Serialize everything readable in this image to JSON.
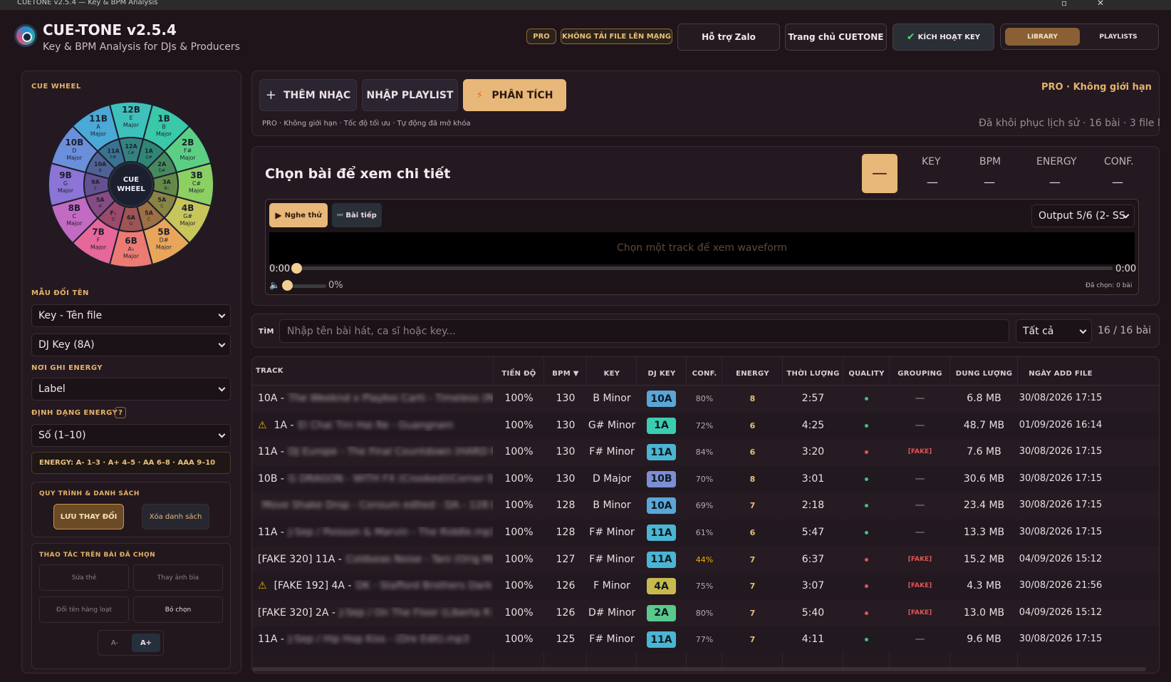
{
  "window": {
    "title": "CUETONE v2.5.4 — Key & BPM Analysis",
    "controls": [
      "▫",
      "✕"
    ]
  },
  "header": {
    "app_name": "CUE-TONE v2.5.4",
    "subtitle": "Key & BPM Analysis for DJs & Producers",
    "pro_badge": "PRO",
    "no_upload_badge": "KHÔNG TẢI FILE LÊN MẠNG",
    "zalo_button": "Hỗ trợ Zalo",
    "home_button": "Trang chủ CUETONE",
    "activate_button": "KÍCH HOẠT KEY",
    "check_icon": "✔",
    "library_tab": "LIBRARY",
    "playlists_tab": "PLAYLISTS"
  },
  "sidebar": {
    "wheel_label": "CUE WHEEL",
    "wheel_center": [
      "CUE",
      "WHEEL"
    ],
    "wheel_outer": [
      {
        "code": "12B",
        "note": "E",
        "mode": "Major",
        "color": "#3fc1bb"
      },
      {
        "code": "1B",
        "note": "B",
        "mode": "Major",
        "color": "#39c9a8"
      },
      {
        "code": "2B",
        "note": "F#",
        "mode": "Major",
        "color": "#5ccf84"
      },
      {
        "code": "3B",
        "note": "C#",
        "mode": "Major",
        "color": "#8ccf62"
      },
      {
        "code": "4B",
        "note": "G#",
        "mode": "Major",
        "color": "#c8c55a"
      },
      {
        "code": "5B",
        "note": "D#",
        "mode": "Major",
        "color": "#e9a55a"
      },
      {
        "code": "6B",
        "note": "A♭",
        "mode": "Major",
        "color": "#ec7b73"
      },
      {
        "code": "7B",
        "note": "F",
        "mode": "Major",
        "color": "#e7679b"
      },
      {
        "code": "8B",
        "note": "C",
        "mode": "Major",
        "color": "#c36ac2"
      },
      {
        "code": "9B",
        "note": "G",
        "mode": "Major",
        "color": "#8c75d6"
      },
      {
        "code": "10B",
        "note": "D",
        "mode": "Major",
        "color": "#6c8fdc"
      },
      {
        "code": "11B",
        "note": "A",
        "mode": "Major",
        "color": "#4aa9d6"
      }
    ],
    "wheel_inner": [
      {
        "code": "12A",
        "note": "C#"
      },
      {
        "code": "1A",
        "note": "G#"
      },
      {
        "code": "2A",
        "note": "D#"
      },
      {
        "code": "3A",
        "note": "B♭"
      },
      {
        "code": "5A",
        "note": "C"
      },
      {
        "code": "5A",
        "note": "C"
      },
      {
        "code": "6A",
        "note": "G"
      },
      {
        "code": "F♭",
        "note": "D"
      },
      {
        "code": "5A",
        "note": "A"
      },
      {
        "code": "9A",
        "note": "E"
      },
      {
        "code": "10A",
        "note": "B"
      },
      {
        "code": "11A",
        "note": "F#"
      }
    ],
    "rename_label": "MẪU ĐỔI TÊN",
    "rename_pattern": "Key - Tên file",
    "key_format": "DJ Key (8A)",
    "energy_target_label": "NƠI GHI ENERGY",
    "energy_target": "Label",
    "energy_format_label": "ĐỊNH DẠNG ENERGY",
    "help_icon": "?",
    "energy_format": "Số (1–10)",
    "energy_legend": "ENERGY: A- 1–3 · A+ 4–5 · AA 6–8 · AAA 9–10",
    "workflow_label": "QUY TRÌNH & DANH SÁCH",
    "save_button": "LƯU THAY ĐỔI",
    "clear_list_button": "Xóa danh sách",
    "selected_actions_label": "THAO TÁC TRÊN BÀI ĐÃ CHỌN",
    "edit_tag_button": "Sửa thẻ",
    "change_cover_button": "Thay ảnh bìa",
    "batch_rename_button": "Đổi tên hàng loạt",
    "deselect_button": "Bỏ chọn",
    "font_minus": "A-",
    "font_plus": "A+"
  },
  "toolbar": {
    "add_music": "THÊM NHẠC",
    "plus_icon": "+",
    "import_playlist": "NHẬP PLAYLIST",
    "analyze": "PHÂN TÍCH",
    "bolt_icon": "⚡",
    "pro_status": "PRO · Không giới hạn",
    "pro_info": "PRO · Không giới hạn · Tốc độ tối ưu · Tự động đã mở khóa",
    "restore_info": "Đã khôi phục lịch sử · 16 bài · 3 file l"
  },
  "detail": {
    "title": "Chọn bài để xem chi tiết",
    "key_label": "KEY",
    "bpm_label": "BPM",
    "energy_label": "ENERGY",
    "conf_label": "CONF.",
    "dash": "—",
    "preview_button": "Nghe thử",
    "play_icon": "▶",
    "next_button": "Bài tiếp",
    "next_icon": "⏭",
    "output": "Output 5/6 (2- SS",
    "waveform_placeholder": "Chọn một track để xem waveform",
    "time_start": "0:00",
    "time_end": "0:00",
    "volume_icon": "🔈",
    "volume": "0%",
    "selected_count": "Đã chọn: 0 bài"
  },
  "search": {
    "label": "TÌM",
    "placeholder": "Nhập tên bài hát, ca sĩ hoặc key...",
    "filter": "Tất cả",
    "count": "16 / 16 bài"
  },
  "table": {
    "headers": [
      "TRACK",
      "TIẾN ĐỘ",
      "BPM ▼",
      "KEY",
      "DJ KEY",
      "CONF.",
      "ENERGY",
      "THỜI LƯỢNG",
      "QUALITY",
      "GROUPING",
      "DUNG LƯỢNG",
      "NGÀY ADD FILE"
    ],
    "warning_icon": "⚠",
    "rows": [
      {
        "prefix": "10A -",
        "name": "The Weeknd x Playboi Carti - Timeless (Remix…",
        "warn": false,
        "progress": "100%",
        "bpm": "130",
        "key": "B Minor",
        "djkey": "10A",
        "djcolor": "#5aa6d8",
        "conf": "80%",
        "energy": "8",
        "duration": "2:57",
        "quality": "#3fc37a",
        "grouping": "—",
        "size": "6.8 MB",
        "date": "30/08/2026 17:15"
      },
      {
        "prefix": "1A -",
        "name": "El Chai Tini Hai Re - Guangnam",
        "warn": true,
        "progress": "100%",
        "bpm": "130",
        "key": "G# Minor",
        "djkey": "1A",
        "djcolor": "#3ccdb0",
        "conf": "72%",
        "energy": "6",
        "duration": "4:25",
        "quality": "#3fc37a",
        "grouping": "—",
        "size": "48.7 MB",
        "date": "01/09/2026 16:14"
      },
      {
        "prefix": "11A -",
        "name": "DJ Europe - The Final Countdown (HARD Re…",
        "warn": false,
        "progress": "100%",
        "bpm": "130",
        "key": "F# Minor",
        "djkey": "11A",
        "djcolor": "#4bb5d3",
        "conf": "84%",
        "energy": "6",
        "duration": "3:20",
        "quality": "#e05555",
        "grouping": "[FAKE]",
        "size": "7.6 MB",
        "date": "30/08/2026 17:15"
      },
      {
        "prefix": "10B -",
        "name": "G DRAGON - WITH FX (Crooked)(Corner Edit)…",
        "warn": false,
        "progress": "100%",
        "bpm": "130",
        "key": "D Major",
        "djkey": "10B",
        "djcolor": "#7c8fd4",
        "conf": "70%",
        "energy": "8",
        "duration": "3:01",
        "quality": "#3fc37a",
        "grouping": "—",
        "size": "30.6 MB",
        "date": "30/08/2026 17:15"
      },
      {
        "prefix": "",
        "name": "Move Shake Drop - Consum edited - DA - 128 bees",
        "warn": false,
        "progress": "100%",
        "bpm": "128",
        "key": "B Minor",
        "djkey": "10A",
        "djcolor": "#5aa6d8",
        "conf": "69%",
        "energy": "7",
        "duration": "2:18",
        "quality": "#3fc37a",
        "grouping": "—",
        "size": "23.4 MB",
        "date": "30/08/2026 17:15"
      },
      {
        "prefix": "11A -",
        "name": "J-Sep / Poisson & Marvin - The Riddle.mp3",
        "warn": false,
        "progress": "100%",
        "bpm": "128",
        "key": "F# Minor",
        "djkey": "11A",
        "djcolor": "#4bb5d3",
        "conf": "61%",
        "energy": "6",
        "duration": "5:47",
        "quality": "#3fc37a",
        "grouping": "—",
        "size": "13.3 MB",
        "date": "30/08/2026 17:15"
      },
      {
        "prefix": "[FAKE 320] 11A -",
        "name": "Coldseas Noise - Tani (Orig Mix)…",
        "warn": false,
        "progress": "100%",
        "bpm": "127",
        "key": "F# Minor",
        "djkey": "11A",
        "djcolor": "#4bb5d3",
        "conf": "44%",
        "energy": "7",
        "duration": "6:37",
        "quality": "#e05555",
        "grouping": "[FAKE]",
        "size": "15.2 MB",
        "date": "04/09/2026 15:12"
      },
      {
        "prefix": "[FAKE 192] 4A -",
        "name": "DK - Stafford Brothers Dark Ne…",
        "warn": true,
        "progress": "100%",
        "bpm": "126",
        "key": "F Minor",
        "djkey": "4A",
        "djcolor": "#c8b94e",
        "conf": "75%",
        "energy": "7",
        "duration": "3:07",
        "quality": "#e05555",
        "grouping": "[FAKE]",
        "size": "4.3 MB",
        "date": "30/08/2026 21:56"
      },
      {
        "prefix": "[FAKE 320] 2A -",
        "name": "J-Sep / On The Floor (Liberta R Lux)…",
        "warn": false,
        "progress": "100%",
        "bpm": "126",
        "key": "D# Minor",
        "djkey": "2A",
        "djcolor": "#59c98c",
        "conf": "80%",
        "energy": "7",
        "duration": "5:40",
        "quality": "#e05555",
        "grouping": "[FAKE]",
        "size": "13.0 MB",
        "date": "04/09/2026 15:12"
      },
      {
        "prefix": "11A -",
        "name": "J-Sep / Hip Hop Kiss - (Dre Edit).mp3",
        "warn": false,
        "progress": "100%",
        "bpm": "125",
        "key": "F# Minor",
        "djkey": "11A",
        "djcolor": "#4bb5d3",
        "conf": "77%",
        "energy": "7",
        "duration": "4:11",
        "quality": "#3fc37a",
        "grouping": "—",
        "size": "9.6 MB",
        "date": "30/08/2026 17:15"
      }
    ]
  },
  "colors": {
    "accent": "#e3b36a",
    "analyze": "#e8b77a",
    "bg": "#1f1419"
  }
}
